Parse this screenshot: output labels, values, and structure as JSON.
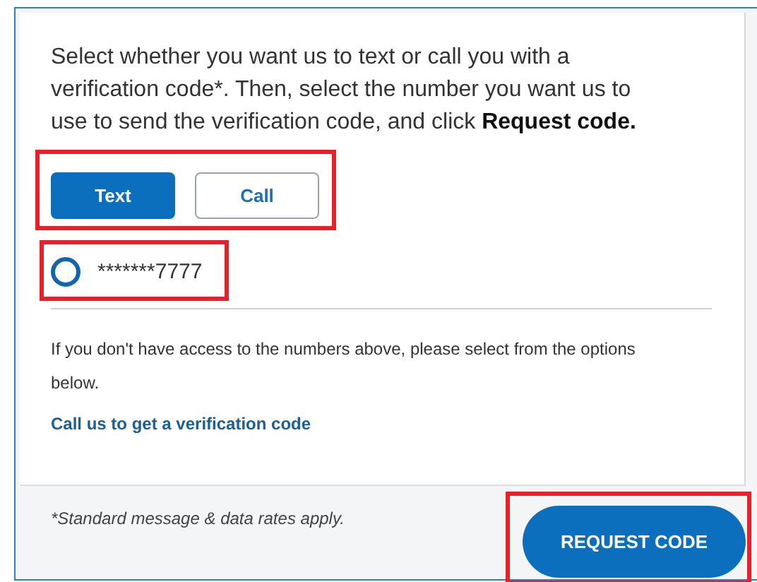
{
  "instructions": "Select whether you want us to text or call you with a verification code*. Then, select the number you want us to use to send the verification code, and click **Request code.**",
  "method_toggle": {
    "highlighted": true,
    "options": [
      {
        "label": "Text",
        "selected": true
      },
      {
        "label": "Call",
        "selected": false
      }
    ]
  },
  "phone_numbers": {
    "highlighted": true,
    "items": [
      {
        "label": "*******7777",
        "selected": false
      }
    ]
  },
  "fallback_note": "If you don't have access to the numbers above, please select from the options below.",
  "call_link": "Call us to get a verification code",
  "footnote": "*Standard message & data rates apply.",
  "submit": {
    "label": "REQUEST CODE",
    "highlighted": true
  }
}
